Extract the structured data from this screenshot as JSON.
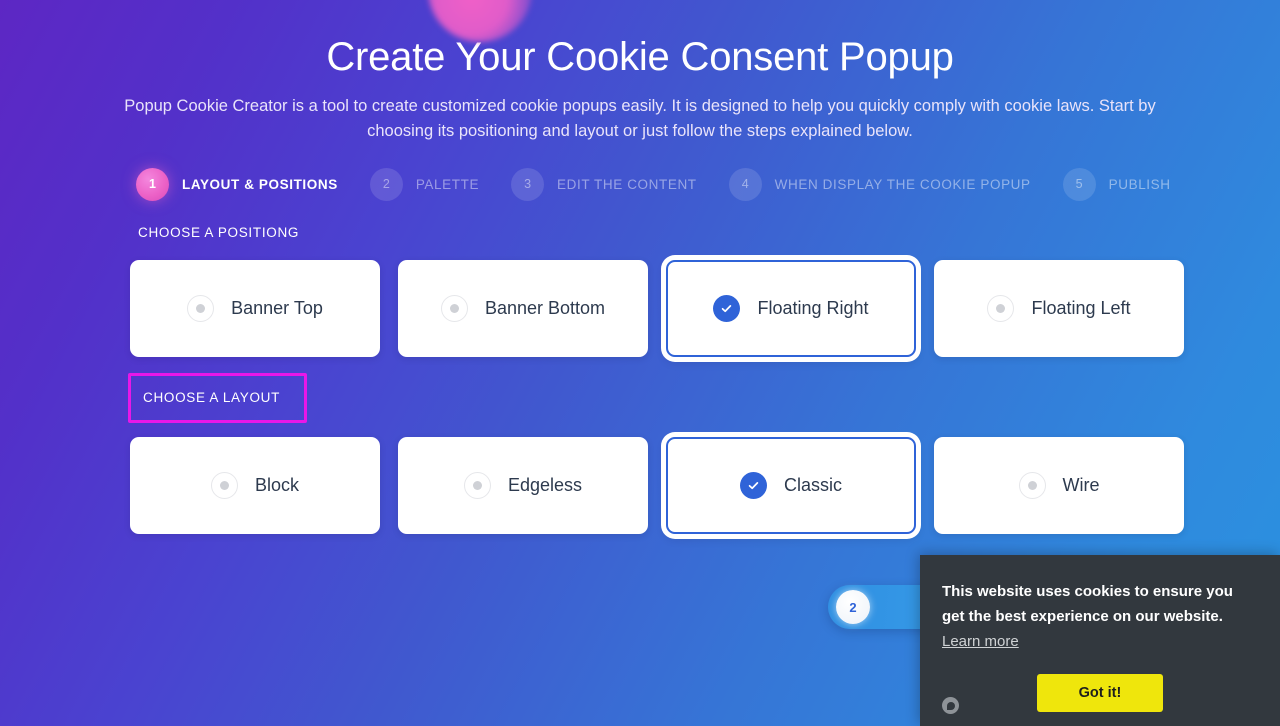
{
  "header": {
    "title": "Create Your Cookie Consent Popup",
    "subtitle": "Popup Cookie Creator is a tool to create customized cookie popups easily. It is designed to help you quickly comply with cookie laws. Start by choosing its positioning and layout or just follow the steps explained below."
  },
  "steps": [
    {
      "number": "1",
      "label": "LAYOUT & POSITIONS",
      "state": "active"
    },
    {
      "number": "2",
      "label": "PALETTE",
      "state": "inactive"
    },
    {
      "number": "3",
      "label": "EDIT THE CONTENT",
      "state": "inactive"
    },
    {
      "number": "4",
      "label": "WHEN DISPLAY THE COOKIE POPUP",
      "state": "inactive"
    },
    {
      "number": "5",
      "label": "PUBLISH",
      "state": "inactive"
    }
  ],
  "positioning": {
    "label": "CHOOSE A POSITIONG",
    "options": [
      {
        "label": "Banner Top",
        "selected": false
      },
      {
        "label": "Banner Bottom",
        "selected": false
      },
      {
        "label": "Floating Right",
        "selected": true
      },
      {
        "label": "Floating Left",
        "selected": false
      }
    ]
  },
  "layout": {
    "label": "CHOOSE A LAYOUT",
    "highlighted": true,
    "highlight_color": "#e817e8",
    "options": [
      {
        "label": "Block",
        "selected": false
      },
      {
        "label": "Edgeless",
        "selected": false
      },
      {
        "label": "Classic",
        "selected": true
      },
      {
        "label": "Wire",
        "selected": false
      }
    ]
  },
  "next_step": {
    "number": "2"
  },
  "cookie_popup": {
    "message": "This website uses cookies to ensure you get the best experience on our website.",
    "link_label": "Learn more",
    "button_label": "Got it!"
  },
  "colors": {
    "accent_blue": "#2f63d8",
    "accent_pink": "#ec62c7",
    "highlight_magenta": "#e817e8",
    "cookie_bg": "#32383e",
    "cookie_button": "#efe60c"
  }
}
